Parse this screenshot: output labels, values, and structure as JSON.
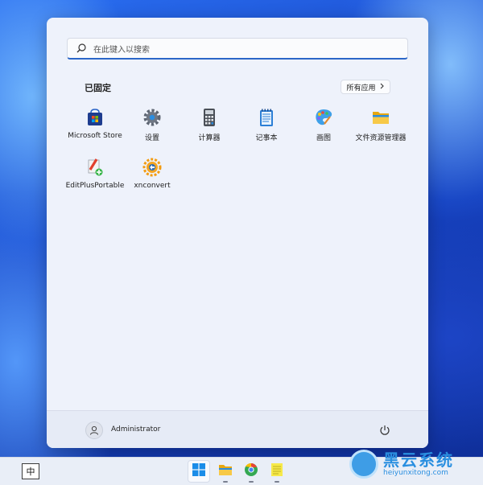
{
  "search": {
    "placeholder": "在此键入以搜索"
  },
  "pinned": {
    "title": "已固定",
    "all_apps_label": "所有应用",
    "apps": [
      {
        "label": "Microsoft Store",
        "icon": "store-icon"
      },
      {
        "label": "设置",
        "icon": "gear-icon"
      },
      {
        "label": "计算器",
        "icon": "calculator-icon"
      },
      {
        "label": "记事本",
        "icon": "notepad-icon"
      },
      {
        "label": "画图",
        "icon": "paint-icon"
      },
      {
        "label": "文件资源管理器",
        "icon": "folder-icon"
      },
      {
        "label": "EditPlusPortable",
        "icon": "editplus-icon"
      },
      {
        "label": "xnconvert",
        "icon": "xnconvert-icon"
      }
    ]
  },
  "user": {
    "name": "Administrator"
  },
  "taskbar": {
    "ime_label": "中",
    "items": [
      {
        "name": "start-button",
        "icon": "windows-icon",
        "active": true
      },
      {
        "name": "file-explorer",
        "icon": "folder-icon"
      },
      {
        "name": "browser",
        "icon": "browser-icon"
      },
      {
        "name": "notes",
        "icon": "notes-icon"
      }
    ]
  },
  "watermark": {
    "title": "黑云系统",
    "subtitle": "heiyunxitong.com"
  },
  "colors": {
    "accent": "#2b66c8",
    "panel": "#eef2fb",
    "watermark": "#2a8fe0"
  }
}
